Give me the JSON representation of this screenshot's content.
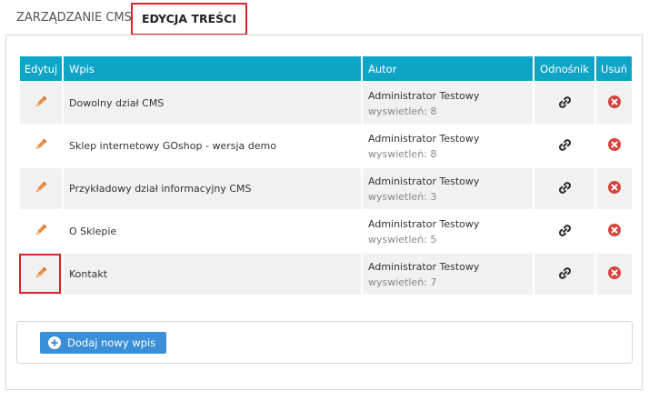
{
  "tabs": [
    {
      "label": "ZARZĄDZANIE CMS",
      "active": false
    },
    {
      "label": "EDYCJA TREŚCI",
      "active": true
    }
  ],
  "table": {
    "headers": {
      "edit": "Edytuj",
      "entry": "Wpis",
      "author": "Autor",
      "link": "Odnośnik",
      "delete": "Usuń"
    },
    "rows": [
      {
        "title": "Dowolny dział CMS",
        "author": "Administrator Testowy",
        "views": "wyswietleń: 8"
      },
      {
        "title": "Sklep internetowy GOshop - wersja demo",
        "author": "Administrator Testowy",
        "views": "wyswietleń: 8"
      },
      {
        "title": "Przykładowy dział informacyjny CMS",
        "author": "Administrator Testowy",
        "views": "wyswietleń: 3"
      },
      {
        "title": "O Sklepie",
        "author": "Administrator Testowy",
        "views": "wyswietleń: 5"
      },
      {
        "title": "Kontakt",
        "author": "Administrator Testowy",
        "views": "wyswietleń: 7"
      }
    ]
  },
  "add_button": {
    "label": "Dodaj nowy wpis"
  },
  "icons": {
    "edit": "pencil-icon",
    "link": "link-icon",
    "delete": "delete-icon",
    "add": "plus-circle-icon"
  },
  "colors": {
    "header": "#0ea4c6",
    "pencil": "#e8904a",
    "delete": "#d9413a",
    "button": "#3b8fd8",
    "highlight": "#d9232d"
  }
}
